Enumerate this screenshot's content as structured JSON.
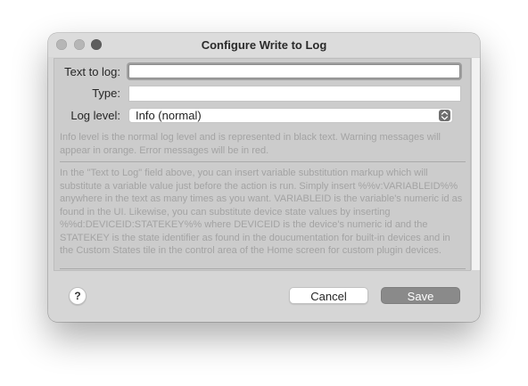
{
  "window": {
    "title": "Configure Write to Log"
  },
  "form": {
    "text_label": "Text to log:",
    "text_value": "",
    "type_label": "Type:",
    "type_value": "",
    "level_label": "Log level:",
    "level_selected": "Info (normal)"
  },
  "help": {
    "level_text": "Info level is the normal log level and is represented in black text. Warning messages will appear in orange. Error messages will be in red.",
    "substitution_text": "In the \"Text to Log\" field above, you can insert variable substitution markup which will substitute a variable value just before the action is run. Simply insert %%v:VARIABLEID%% anywhere in the text as many times as you want. VARIABLEID is the variable's numeric id as found in the UI. Likewise, you can substitute device state values by inserting %%d:DEVICEID:STATEKEY%% where DEVICEID is the device's numeric id and the STATEKEY is the state identifier as found in the doucumentation for built-in devices and in the Custom States tile in the control area of the Home screen for custom plugin devices."
  },
  "buttons": {
    "help": "?",
    "cancel": "Cancel",
    "save": "Save"
  },
  "colors": {
    "save_button": "#8a8a8a",
    "window_bg": "#d6d6d6",
    "help_text": "#a3a3a3"
  }
}
